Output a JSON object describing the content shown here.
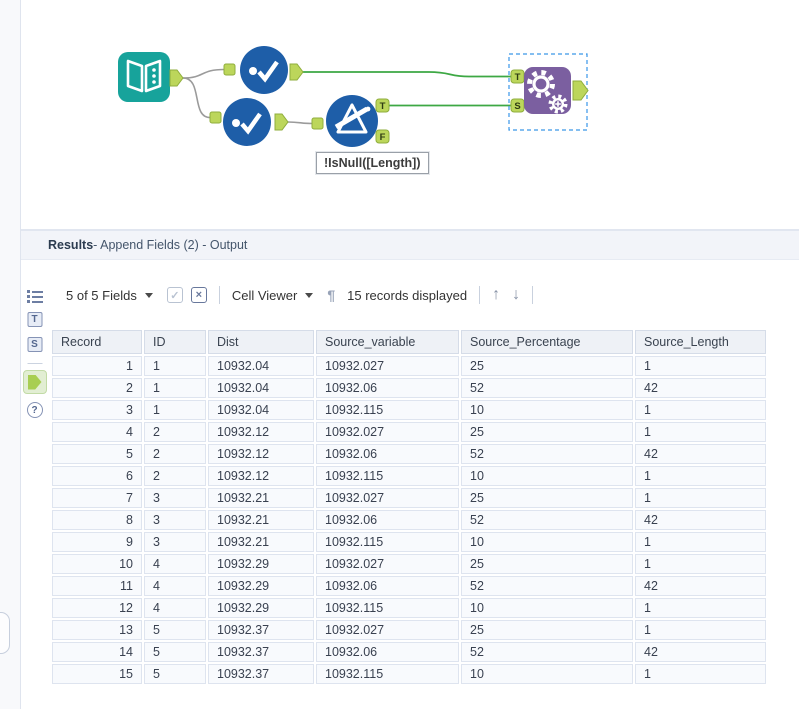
{
  "canvas": {
    "annotation": "!IsNull([Length])",
    "anchor_labels": {
      "t": "T",
      "f": "F",
      "s": "S"
    },
    "colors": {
      "tool_blue": "#1E5EA8",
      "tool_teal": "#17A39B",
      "tool_purple": "#7B5FA0",
      "anchor_green": "#BCD65B",
      "anchor_border": "#8FAE3C",
      "wire_green": "#3DA844",
      "wire_gray": "#9B9B9B",
      "selection_blue": "#3A96E8"
    },
    "tools": [
      "input-data-tool",
      "select-tool",
      "select-tool",
      "filter-tool",
      "append-fields-tool"
    ]
  },
  "results": {
    "title": {
      "bold": "Results",
      "rest": " - Append Fields (2) - Output"
    },
    "toolbar": {
      "fields_dropdown": "5 of 5 Fields",
      "cell_viewer": "Cell Viewer",
      "records_status": "15 records displayed"
    },
    "icons": {
      "check": "✓",
      "close": "×",
      "pilcrow": "¶",
      "arrow_up": "↑",
      "arrow_down": "↓",
      "help": "?",
      "tag_t": "T",
      "tag_s": "S"
    },
    "table": {
      "columns": [
        "Record",
        "ID",
        "Dist",
        "Source_variable",
        "Source_Percentage",
        "Source_Length"
      ],
      "rows": [
        [
          "1",
          "1",
          "10932.04",
          "10932.027",
          "25",
          "1"
        ],
        [
          "2",
          "1",
          "10932.04",
          "10932.06",
          "52",
          "42"
        ],
        [
          "3",
          "1",
          "10932.04",
          "10932.115",
          "10",
          "1"
        ],
        [
          "4",
          "2",
          "10932.12",
          "10932.027",
          "25",
          "1"
        ],
        [
          "5",
          "2",
          "10932.12",
          "10932.06",
          "52",
          "42"
        ],
        [
          "6",
          "2",
          "10932.12",
          "10932.115",
          "10",
          "1"
        ],
        [
          "7",
          "3",
          "10932.21",
          "10932.027",
          "25",
          "1"
        ],
        [
          "8",
          "3",
          "10932.21",
          "10932.06",
          "52",
          "42"
        ],
        [
          "9",
          "3",
          "10932.21",
          "10932.115",
          "10",
          "1"
        ],
        [
          "10",
          "4",
          "10932.29",
          "10932.027",
          "25",
          "1"
        ],
        [
          "11",
          "4",
          "10932.29",
          "10932.06",
          "52",
          "42"
        ],
        [
          "12",
          "4",
          "10932.29",
          "10932.115",
          "10",
          "1"
        ],
        [
          "13",
          "5",
          "10932.37",
          "10932.027",
          "25",
          "1"
        ],
        [
          "14",
          "5",
          "10932.37",
          "10932.06",
          "52",
          "42"
        ],
        [
          "15",
          "5",
          "10932.37",
          "10932.115",
          "10",
          "1"
        ]
      ]
    }
  }
}
